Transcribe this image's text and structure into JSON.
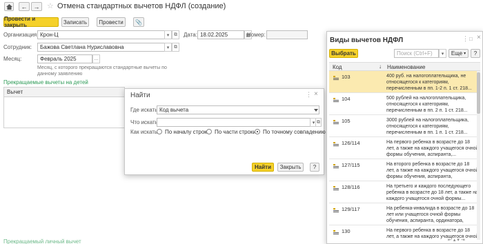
{
  "window": {
    "title": "Отмена стандартных вычетов НДФЛ (создание)"
  },
  "toolbar": {
    "post_close": "Провести и закрыть",
    "save": "Записать",
    "post": "Провести"
  },
  "form": {
    "org_label": "Организация:",
    "org_value": "Крон-Ц",
    "date_label": "Дата:",
    "date_value": "18.02.2025",
    "number_label": "Номер:",
    "number_value": "",
    "employee_label": "Сотрудник:",
    "employee_value": "Бажова Светлана Нуриславовна",
    "month_label": "Месяц:",
    "month_value": "Февраль 2025",
    "month_hint": "Месяц, с которого прекращаются стандартные вычеты по данному заявлению",
    "section_link": "Прекращаемые вычеты на детей",
    "table_header": "Вычет",
    "bottom_link": "Прекращаемый личный вычет"
  },
  "find_dialog": {
    "title": "Найти",
    "where_label": "Где искать:",
    "where_value": "Код вычета",
    "what_label": "Что искать:",
    "what_value": "",
    "how_label": "Как искать:",
    "options": [
      "По началу строки",
      "По части строки",
      "По точному совпадению"
    ],
    "selected_option": 2,
    "find_button": "Найти",
    "close_button": "Закрыть",
    "help_button": "?"
  },
  "picker": {
    "title": "Виды вычетов НДФЛ",
    "select_button": "Выбрать",
    "search_placeholder": "Поиск (Ctrl+F)",
    "more_button": "Еще",
    "help_button": "?",
    "col_code": "Код",
    "col_sort": "↓",
    "col_name": "Наименование",
    "rows": [
      {
        "code": "103",
        "name": "400 руб. на налогоплательщика, не относящегося к категориям, перечисленным в пп. 1-2 п. 1 ст. 218...",
        "selected": true
      },
      {
        "code": "104",
        "name": "500 рублей на налогоплательщика, относящегося к категориям, перечисленным в пп. 2 п. 1 ст. 218...",
        "selected": false
      },
      {
        "code": "105",
        "name": "3000 рублей на налогоплательщика, относящегося к категориям, перечисленным в пп. 1 п. 1 ст. 218...",
        "selected": false
      },
      {
        "code": "126/114",
        "name": "На первого ребенка в возрасте до 18 лет, а также на каждого учащегося очной формы обучения, аспиранта,...",
        "selected": false
      },
      {
        "code": "127/115",
        "name": "На второго ребенка в возрасте до 18 лет, а также на каждого учащегося очной формы обучения, аспиранта, ординатора,...",
        "selected": false
      },
      {
        "code": "128/116",
        "name": "На третьего и каждого последующего ребенка в возрасте до 18 лет, а также на каждого учащегося очной формы...",
        "selected": false
      },
      {
        "code": "129/117",
        "name": "На ребенка-инвалида в возрасте до 18 лет или учащегося очной формы обучения, аспиранта, ординатора, интерна,...",
        "selected": false
      },
      {
        "code": "130",
        "name": "На первого ребенка в возрасте до 18 лет, а также на каждого учащегося очной формы обучения, ...",
        "selected": false
      }
    ]
  },
  "colors": {
    "accent": "#f5d12a",
    "link": "#2e9b57",
    "selection": "#fbeab0"
  }
}
